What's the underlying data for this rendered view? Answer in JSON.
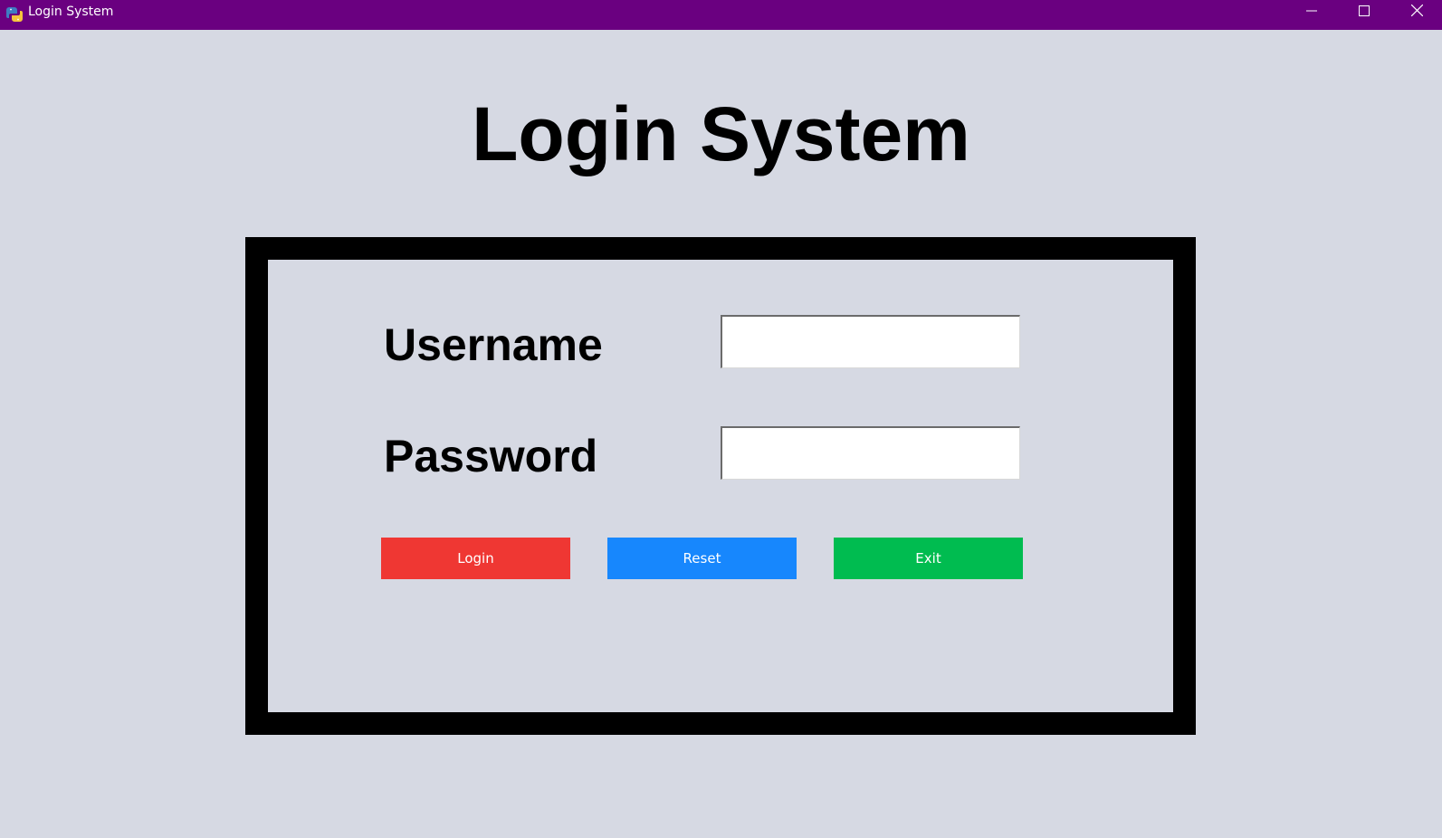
{
  "window": {
    "title": "Login System",
    "icon": "python-app-icon",
    "controls": [
      "minimize-icon",
      "maximize-icon",
      "close-icon"
    ]
  },
  "page": {
    "heading": "Login System"
  },
  "form": {
    "username_label": "Username",
    "username_value": "",
    "password_label": "Password",
    "password_value": ""
  },
  "buttons": {
    "login": "Login",
    "reset": "Reset",
    "exit": "Exit"
  },
  "colors": {
    "titlebar": "#6a0080",
    "background": "#d6d9e3",
    "login": "#ef3733",
    "reset": "#1787fd",
    "exit": "#00bc50"
  }
}
